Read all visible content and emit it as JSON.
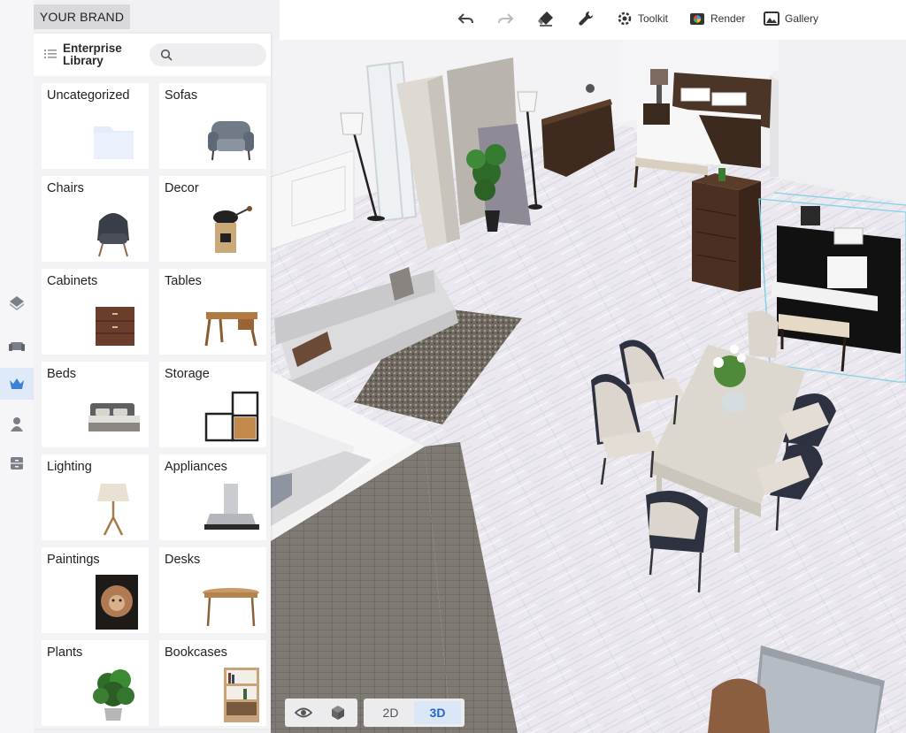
{
  "brand": {
    "label": "YOUR BRAND"
  },
  "library": {
    "title": "Enterprise Library",
    "search_placeholder": "",
    "categories": [
      {
        "label": "Uncategorized",
        "icon": "folder-icon"
      },
      {
        "label": "Sofas",
        "icon": "armchair-icon"
      },
      {
        "label": "Chairs",
        "icon": "chair-icon"
      },
      {
        "label": "Decor",
        "icon": "grinder-icon"
      },
      {
        "label": "Cabinets",
        "icon": "cabinet-icon"
      },
      {
        "label": "Tables",
        "icon": "desk-table-icon"
      },
      {
        "label": "Beds",
        "icon": "bed-icon"
      },
      {
        "label": "Storage",
        "icon": "shelf-icon"
      },
      {
        "label": "Lighting",
        "icon": "floor-lamp-icon"
      },
      {
        "label": "Appliances",
        "icon": "range-hood-icon"
      },
      {
        "label": "Paintings",
        "icon": "lion-painting-icon"
      },
      {
        "label": "Desks",
        "icon": "desk-icon"
      },
      {
        "label": "Plants",
        "icon": "plant-icon"
      },
      {
        "label": "Bookcases",
        "icon": "bookcase-icon"
      }
    ]
  },
  "toolbar": {
    "toolkit_label": "Toolkit",
    "render_label": "Render",
    "gallery_label": "Gallery"
  },
  "view_modes": {
    "mode_2d": "2D",
    "mode_3d": "3D",
    "active": "3D"
  },
  "colors": {
    "accent": "#2a66c8",
    "active_bg": "#dbe6f7",
    "selection": "#7fd3e6"
  }
}
